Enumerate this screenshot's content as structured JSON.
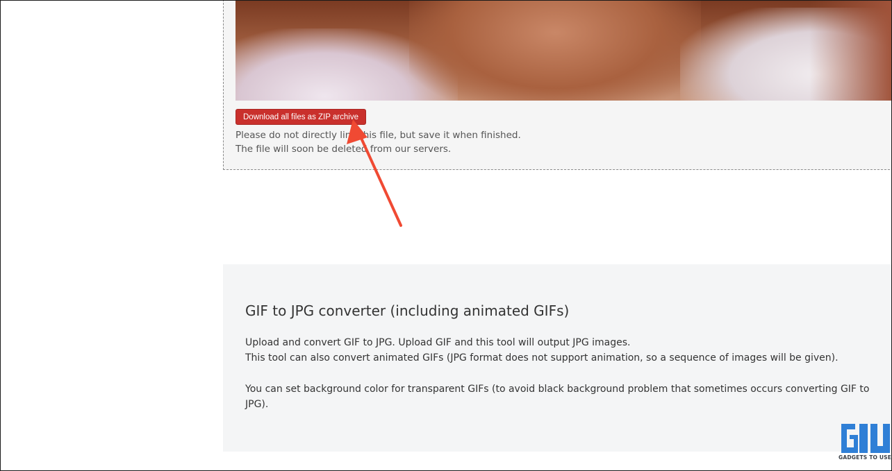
{
  "result": {
    "download_zip_label": "Download all files as ZIP archive",
    "notice_line1": "Please do not directly link this file, but save it when finished.",
    "notice_line2": "The file will soon be deleted from our servers."
  },
  "info": {
    "title": "GIF to JPG converter (including animated GIFs)",
    "paragraph1_line1": "Upload and convert GIF to JPG. Upload GIF and this tool will output JPG images.",
    "paragraph1_line2": "This tool can also convert animated GIFs (JPG format does not support animation, so a sequence of images will be given).",
    "paragraph2": "You can set background color for transparent GIFs (to avoid black background problem that sometimes occurs converting GIF to JPG)."
  },
  "watermark": {
    "text": "GADGETS TO USE"
  },
  "colors": {
    "button": "#c9302c",
    "arrow": "#f04a33",
    "panel_bg": "#f4f5f6",
    "watermark_blue": "#2f7fd6"
  },
  "icons": {
    "annotation": "red-arrow-icon",
    "brand": "gadgets-to-use-logo-icon"
  }
}
